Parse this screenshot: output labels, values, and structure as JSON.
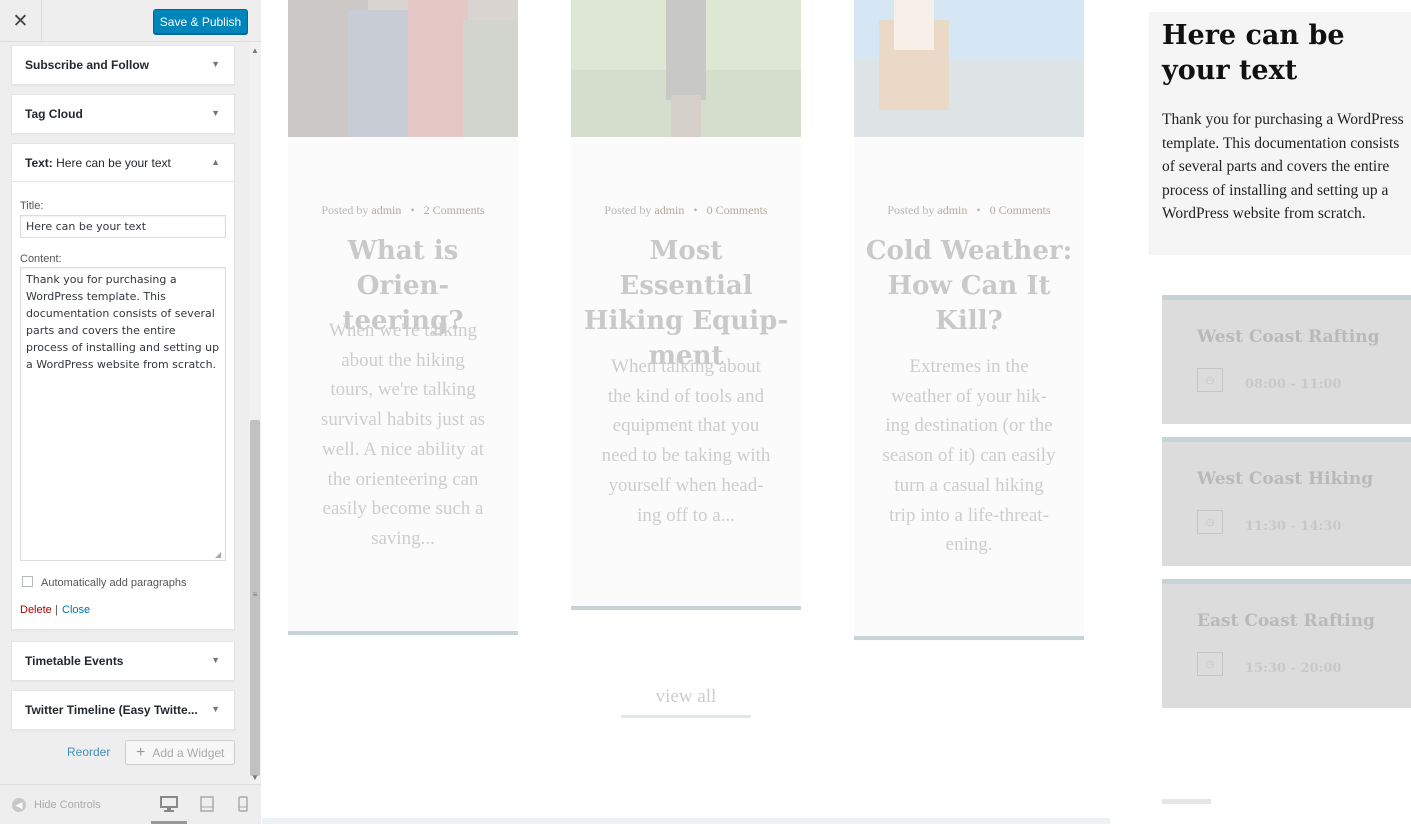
{
  "customizer": {
    "close_glyph": "✕",
    "save_label": "Save & Publish",
    "widgets_collapsed_top": [
      {
        "label": "Subscribe and Follow"
      },
      {
        "label": "Tag Cloud"
      }
    ],
    "text_widget": {
      "header_bold": "Text:",
      "header_name": " Here can be your text",
      "title_label": "Title:",
      "title_value": "Here can be your text",
      "content_label": "Content:",
      "content_value": "Thank you for purchasing a WordPress template. This documentation consists of several parts and covers the entire process of installing and setting up a WordPress website from scratch.",
      "auto_paragraphs_label": "Automatically add paragraphs",
      "auto_paragraphs_checked": false,
      "delete_label": "Delete",
      "separator": "|",
      "close_label": "Close"
    },
    "widgets_collapsed_bottom": [
      {
        "label": "Timetable Events"
      },
      {
        "label": "Twitter Timeline (Easy Twitte..."
      }
    ],
    "reorder_label": "Reorder",
    "add_widget_label": "Add a Widget",
    "hide_controls_label": "Hide Controls",
    "accent_color": "#0085ba"
  },
  "preview": {
    "posts": [
      {
        "meta_prefix": "Posted by",
        "author": "admin",
        "comments": "2 Comments",
        "title_lines": [
          "What is Orien-",
          "teering?"
        ],
        "excerpt_lines": [
          "When we're talking",
          "about the hiking",
          "tours, we're talking",
          "survival habits just as",
          "well. A nice ability at",
          "the orienteering can",
          "easily become such a",
          "saving..."
        ]
      },
      {
        "meta_prefix": "Posted by",
        "author": "admin",
        "comments": "0 Comments",
        "title_lines": [
          "Most Essential",
          "Hiking Equip-",
          "ment"
        ],
        "excerpt_lines": [
          "When talking about",
          "the kind of tools and",
          "equipment that you",
          "need to be taking with",
          "yourself when head-",
          "ing off to a..."
        ]
      },
      {
        "meta_prefix": "Posted by",
        "author": "admin",
        "comments": "0 Comments",
        "title_lines": [
          "Cold Weather:",
          "How Can It",
          "Kill?"
        ],
        "excerpt_lines": [
          "Extremes in the",
          "weather of your hik-",
          "ing destination (or the",
          "season of it) can easily",
          "turn a casual hiking",
          "trip into a life-threat-",
          "ening."
        ]
      }
    ],
    "view_all_label": "view all",
    "text_widget": {
      "heading": "Here can be your text",
      "body": "Thank you for purchasing a WordPress template. This documentation consists of several parts and covers the entire process of installing and setting up a WordPress website from scratch."
    },
    "events": [
      {
        "title": "West Coast Rafting",
        "time": "08:00 - 11:00"
      },
      {
        "title": "West Coast Hiking",
        "time": "11:30 - 14:30"
      },
      {
        "title": "East Coast Rafting",
        "time": "15:30 - 20:00"
      }
    ]
  }
}
